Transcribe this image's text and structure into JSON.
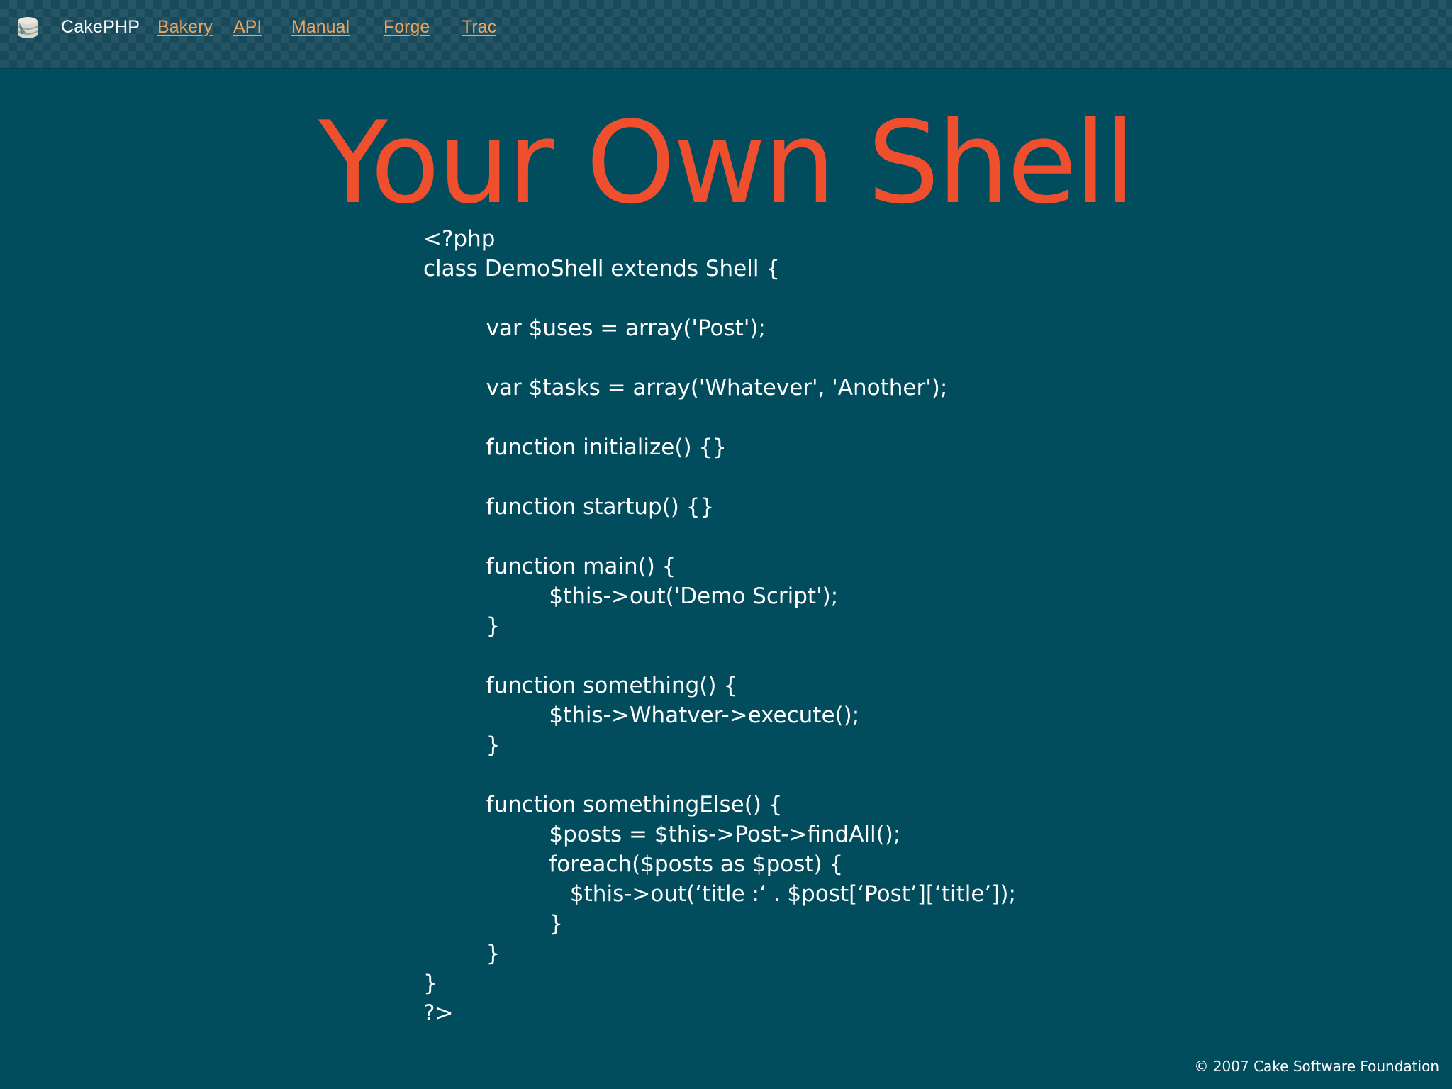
{
  "header": {
    "brand": "CakePHP",
    "logo_icon": "cakephp-logo-icon",
    "nav": [
      {
        "label": "Bakery"
      },
      {
        "label": "API"
      },
      {
        "label": "Manual"
      },
      {
        "label": "Forge"
      },
      {
        "label": "Trac"
      }
    ]
  },
  "slide": {
    "title": "Your Own Shell",
    "code_lines": [
      "<?php",
      "class DemoShell extends Shell {",
      "",
      "         var $uses = array('Post');",
      "",
      "         var $tasks = array('Whatever', 'Another');",
      "",
      "         function initialize() {}",
      "",
      "         function startup() {}",
      "",
      "         function main() {",
      "                  $this->out('Demo Script');",
      "         }",
      "",
      "         function something() {",
      "                  $this->Whatver->execute();",
      "         }",
      "",
      "         function somethingElse() {",
      "                  $posts = $this->Post->findAll();",
      "                  foreach($posts as $post) {",
      "                     $this->out(‘title :‘ . $post[‘Post’][‘title’]);",
      "                  }",
      "         }",
      "}",
      "?>"
    ]
  },
  "footer": {
    "copyright": "© 2007 Cake Software Foundation"
  },
  "colors": {
    "background": "#014c5d",
    "title": "#f04f2e",
    "link": "#f0a35c",
    "text": "#ffffff"
  }
}
